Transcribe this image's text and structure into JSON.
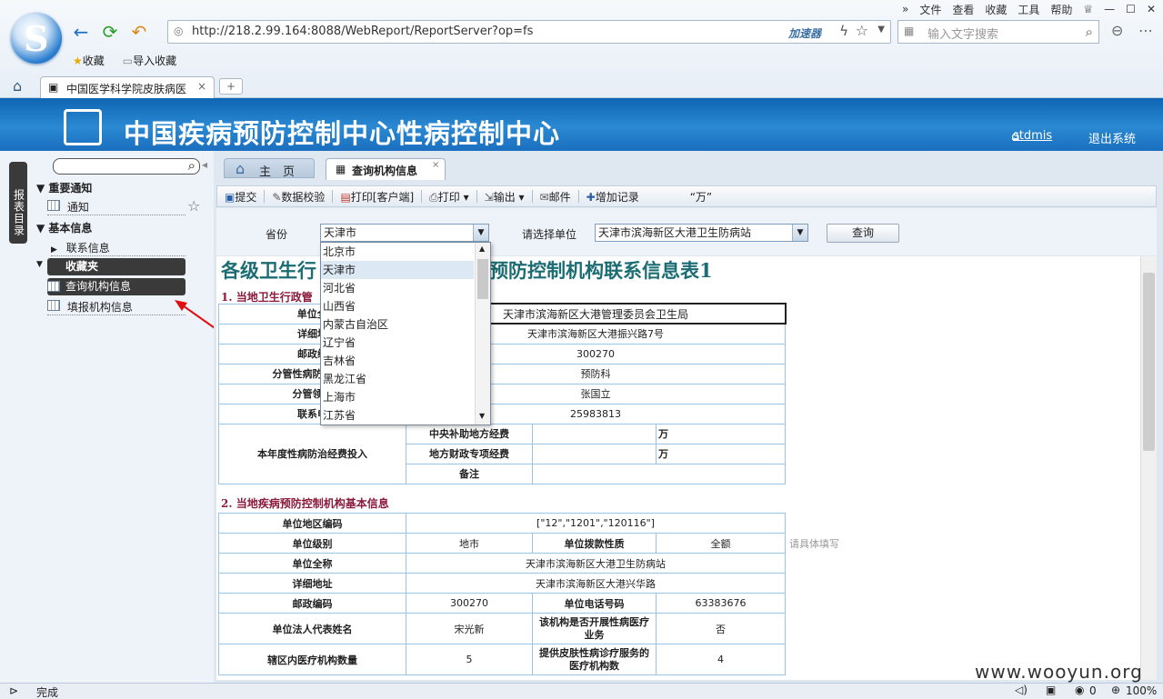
{
  "browser": {
    "menu": [
      "文件",
      "查看",
      "收藏",
      "工具",
      "帮助"
    ],
    "url": "http://218.2.99.164:8088/WebReport/ReportServer?op=fs",
    "accelerator": "加速器",
    "search_placeholder": "输入文字搜索",
    "favorites": [
      "收藏",
      "导入收藏"
    ],
    "tab_title": "中国医学科学院皮肤病医",
    "status": "完成",
    "zoom": "100%",
    "counter": "0"
  },
  "app": {
    "title": "中国疾病预防控制中心性病控制中心",
    "user": "stdmis",
    "logout": "退出系统"
  },
  "sidebar": {
    "side_tab": "报表目录",
    "groups": [
      {
        "label": "重要通知",
        "items": [
          "通知"
        ]
      },
      {
        "label": "基本信息",
        "items": [
          "联系信息"
        ]
      },
      {
        "label": "收藏夹",
        "items": [
          "查询机构信息",
          "填报机构信息"
        ]
      }
    ]
  },
  "tabs": {
    "home": "主　页",
    "active": "查询机构信息"
  },
  "toolbar": [
    "提交",
    "数据校验",
    "打印[客户端]",
    "打印",
    "输出",
    "邮件",
    "增加记录",
    "“万”"
  ],
  "params": {
    "province_label": "省份",
    "province_value": "天津市",
    "unit_label": "请选择单位",
    "unit_value": "天津市滨海新区大港卫生防病站",
    "query": "查询"
  },
  "dropdown_options": [
    "北京市",
    "天津市",
    "河北省",
    "山西省",
    "内蒙古自治区",
    "辽宁省",
    "吉林省",
    "黑龙江省",
    "上海市",
    "江苏省"
  ],
  "report": {
    "title_left": "各级卫生行",
    "title_right": "预防控制机构联系信息表1",
    "section1": "1. 当地卫生行政管",
    "s1_rows": [
      {
        "label": "单位全",
        "value": "天津市滨海新区大港管理委员会卫生局"
      },
      {
        "label": "详细地",
        "value": "天津市滨海新区大港振兴路7号"
      },
      {
        "label": "邮政编",
        "value": "300270"
      },
      {
        "label": "分管性病防治工作",
        "value": "预防科"
      },
      {
        "label": "分管领导",
        "value": "张国立"
      },
      {
        "label": "联系电",
        "value": "25983813"
      }
    ],
    "funding_label": "本年度性病防治经费投入",
    "funding_rows": [
      {
        "label": "中央补助地方经费",
        "value": "",
        "unit": "万"
      },
      {
        "label": "地方财政专项经费",
        "value": "",
        "unit": "万"
      },
      {
        "label": "备注",
        "value": "",
        "unit": ""
      }
    ],
    "section2": "2. 当地疾病预防控制机构基本信息",
    "s2": {
      "area_code_label": "单位地区编码",
      "area_code": "[\"12\",\"1201\",\"120116\"]",
      "level_label": "单位级别",
      "level": "地市",
      "funding_type_label": "单位拨款性质",
      "funding_type": "全额",
      "hint": "请具体填写",
      "name_label": "单位全称",
      "name": "天津市滨海新区大港卫生防病站",
      "addr_label": "详细地址",
      "addr": "天津市滨海新区大港兴华路",
      "zip_label": "邮政编码",
      "zip": "300270",
      "phone_label": "单位电话号码",
      "phone": "63383676",
      "legal_label": "单位法人代表姓名",
      "legal": "宋光新",
      "std_label": "该机构是否开展性病医疗业务",
      "std": "否",
      "count_label": "辖区内医疗机构数量",
      "count": "5",
      "derm_label": "提供皮肤性病诊疗服务的医疗机构数",
      "derm": "4"
    }
  },
  "watermark": "www.wooyun.org"
}
